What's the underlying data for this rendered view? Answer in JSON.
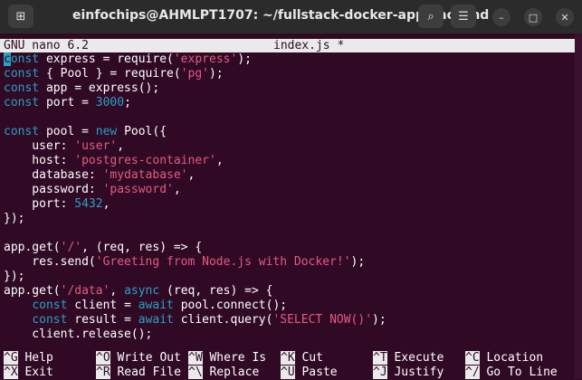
{
  "window": {
    "title": "einfochips@AHMLPT1707: ~/fullstack-docker-app/backend",
    "new_tab_glyph": "⊞",
    "search_glyph": "⌕",
    "menu_glyph": "☰",
    "minimize_glyph": "–",
    "maximize_glyph": "□",
    "close_glyph": "✕"
  },
  "nano": {
    "version": "GNU nano 6.2",
    "filename": "index.js *"
  },
  "code_lines": [
    [
      {
        "t": "c",
        "c": "cursor"
      },
      {
        "t": "onst",
        "c": "kw"
      },
      {
        "t": " express = require("
      },
      {
        "t": "'express'",
        "c": "str"
      },
      {
        "t": ");"
      }
    ],
    [
      {
        "t": "const",
        "c": "kw"
      },
      {
        "t": " { Pool } = require("
      },
      {
        "t": "'pg'",
        "c": "str"
      },
      {
        "t": ");"
      }
    ],
    [
      {
        "t": "const",
        "c": "kw"
      },
      {
        "t": " app = express();"
      }
    ],
    [
      {
        "t": "const",
        "c": "kw"
      },
      {
        "t": " port = "
      },
      {
        "t": "3000",
        "c": "num"
      },
      {
        "t": ";"
      }
    ],
    [],
    [
      {
        "t": "const",
        "c": "kw"
      },
      {
        "t": " pool = "
      },
      {
        "t": "new",
        "c": "kw"
      },
      {
        "t": " Pool({"
      }
    ],
    [
      {
        "t": "    user: "
      },
      {
        "t": "'user'",
        "c": "str"
      },
      {
        "t": ","
      }
    ],
    [
      {
        "t": "    host: "
      },
      {
        "t": "'postgres-container'",
        "c": "str"
      },
      {
        "t": ","
      }
    ],
    [
      {
        "t": "    database: "
      },
      {
        "t": "'mydatabase'",
        "c": "str"
      },
      {
        "t": ","
      }
    ],
    [
      {
        "t": "    password: "
      },
      {
        "t": "'password'",
        "c": "str"
      },
      {
        "t": ","
      }
    ],
    [
      {
        "t": "    port: "
      },
      {
        "t": "5432",
        "c": "num"
      },
      {
        "t": ","
      }
    ],
    [
      {
        "t": "});"
      }
    ],
    [],
    [
      {
        "t": "app.get("
      },
      {
        "t": "'/'",
        "c": "str"
      },
      {
        "t": ", (req, res) => {"
      }
    ],
    [
      {
        "t": "    res.send("
      },
      {
        "t": "'Greeting from Node.js with Docker!'",
        "c": "str"
      },
      {
        "t": ");"
      }
    ],
    [
      {
        "t": "});"
      }
    ],
    [
      {
        "t": "app.get("
      },
      {
        "t": "'/data'",
        "c": "str"
      },
      {
        "t": ", "
      },
      {
        "t": "async",
        "c": "kw"
      },
      {
        "t": " (req, res) => {"
      }
    ],
    [
      {
        "t": "    "
      },
      {
        "t": "const",
        "c": "kw"
      },
      {
        "t": " client = "
      },
      {
        "t": "await",
        "c": "kw"
      },
      {
        "t": " pool.connect();"
      }
    ],
    [
      {
        "t": "    "
      },
      {
        "t": "const",
        "c": "kw"
      },
      {
        "t": " result = "
      },
      {
        "t": "await",
        "c": "kw"
      },
      {
        "t": " client.query("
      },
      {
        "t": "'SELECT NOW()'",
        "c": "str"
      },
      {
        "t": ");"
      }
    ],
    [
      {
        "t": "    client.release();"
      }
    ]
  ],
  "shortcuts": {
    "row1": [
      {
        "key": "^G",
        "label": "Help",
        "col": 0
      },
      {
        "key": "^O",
        "label": "Write Out",
        "col": 1
      },
      {
        "key": "^W",
        "label": "Where Is",
        "col": 2
      },
      {
        "key": "^K",
        "label": "Cut",
        "col": 3
      },
      {
        "key": "^T",
        "label": "Execute",
        "col": 4
      },
      {
        "key": "^C",
        "label": "Location",
        "col": 5
      }
    ],
    "row2": [
      {
        "key": "^X",
        "label": "Exit",
        "col": 0
      },
      {
        "key": "^R",
        "label": "Read File",
        "col": 1
      },
      {
        "key": "^\\",
        "label": "Replace",
        "col": 2
      },
      {
        "key": "^U",
        "label": "Paste",
        "col": 3
      },
      {
        "key": "^J",
        "label": "Justify",
        "col": 4
      },
      {
        "key": "^/",
        "label": "Go To Line",
        "col": 5
      }
    ]
  }
}
